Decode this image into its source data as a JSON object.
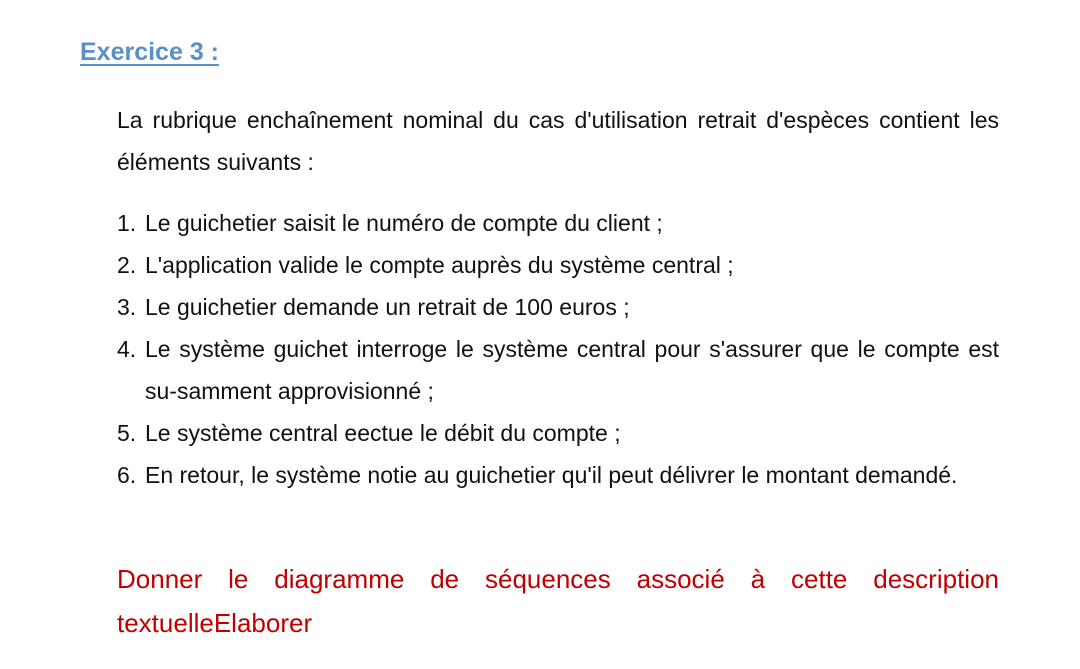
{
  "document": {
    "heading": "Exercice 3 :",
    "intro": "La rubrique  enchaînement nominal  du cas d'utilisation retrait d'espèces contient les éléments suivants :",
    "steps": [
      {
        "number": "1.",
        "text": "Le guichetier saisit le numéro de compte du client ;"
      },
      {
        "number": "2.",
        "text": "L'application valide le compte auprès du système central ;"
      },
      {
        "number": "3.",
        "text": "Le guichetier demande un retrait de 100 euros ;"
      },
      {
        "number": "4.",
        "text": "Le système  guichet interroge le système central pour s'assurer que le compte est su-samment approvisionné ;"
      },
      {
        "number": "5.",
        "text": "Le système central eectue le débit du compte ;"
      },
      {
        "number": "6.",
        "text": "En retour, le système notie au guichetier qu'il peut délivrer le montant demandé."
      }
    ],
    "instruction": "Donner le diagramme de séquences associé à cette description textuelleElaborer"
  },
  "colors": {
    "heading": "#5b8fc9",
    "body_text": "#111111",
    "instruction": "#c00000",
    "background": "#ffffff"
  }
}
